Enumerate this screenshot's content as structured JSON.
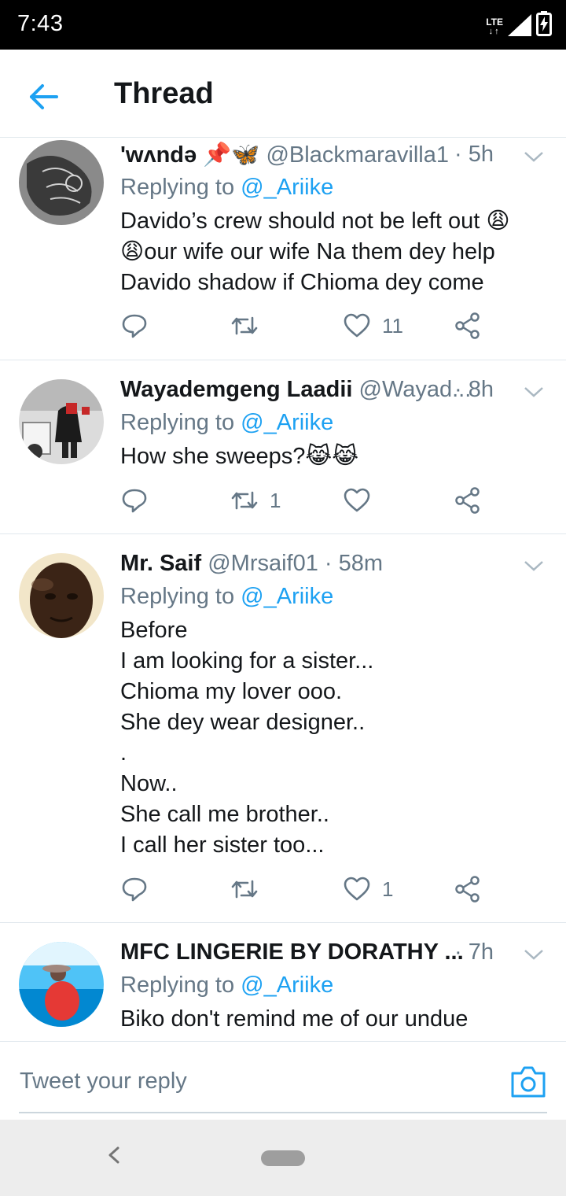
{
  "status_bar": {
    "time": "7:43",
    "network": "LTE"
  },
  "header": {
    "title": "Thread"
  },
  "tweets": [
    {
      "name": "'wʌndə 📌🦋",
      "handle": "@Blackmaravilla1",
      "time": "· 5h",
      "replying_prefix": "Replying to ",
      "replying_to": "@_Ariike",
      "lines": [
        "Davido’s crew should not be left out 😩",
        "😩our wife our wife Na them dey help",
        "Davido shadow if Chioma dey come"
      ],
      "retweets": "",
      "likes": "11"
    },
    {
      "name": "Wayademgeng Laadii",
      "handle": "@Wayad...",
      "time": "· 8h",
      "replying_prefix": "Replying to ",
      "replying_to": "@_Ariike",
      "lines": [
        "How she sweeps?😹😹"
      ],
      "retweets": "1",
      "likes": ""
    },
    {
      "name": "Mr. Saif",
      "handle": "@Mrsaif01",
      "time": "· 58m",
      "replying_prefix": "Replying to ",
      "replying_to": "@_Ariike",
      "lines": [
        "Before",
        "I am looking for a sister...",
        "Chioma my lover ooo.",
        "She dey wear designer..",
        ".",
        "Now..",
        "She call me brother..",
        "I call her sister too..."
      ],
      "retweets": "",
      "likes": "1"
    },
    {
      "name": "MFC LINGERIE BY DORATHY ...",
      "handle": "",
      "time": "· 7h",
      "replying_prefix": "Replying to ",
      "replying_to": "@_Ariike",
      "lines": [
        "Biko don't remind me of our undue"
      ],
      "retweets": "",
      "likes": ""
    }
  ],
  "reply_bar": {
    "placeholder": "Tweet your reply"
  },
  "colors": {
    "accent": "#1da1f2",
    "secondary_text": "#657786",
    "divider": "#e1e8ed"
  }
}
